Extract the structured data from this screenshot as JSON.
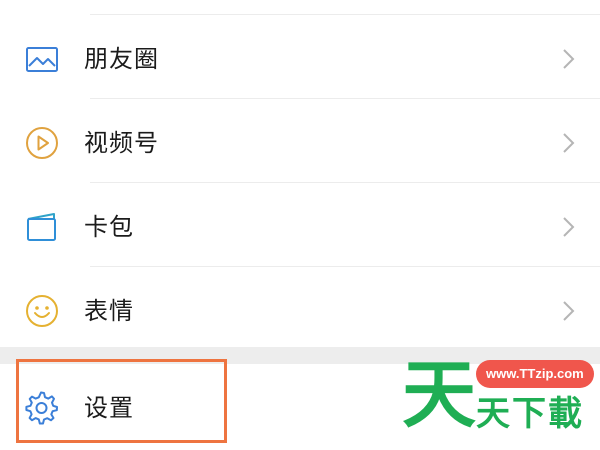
{
  "menu": {
    "items": [
      {
        "label": "朋友圈",
        "icon": "moments-image-icon",
        "icon_color": "#3b7fd8"
      },
      {
        "label": "视频号",
        "icon": "channels-play-icon",
        "icon_color": "#e0a23f"
      },
      {
        "label": "卡包",
        "icon": "card-wallet-icon",
        "icon_color": "#2f8fd8"
      },
      {
        "label": "表情",
        "icon": "sticker-smiley-icon",
        "icon_color": "#e5b131"
      }
    ],
    "settings": {
      "label": "设置",
      "icon": "gear-icon",
      "icon_color": "#3b7fd8"
    }
  },
  "highlight": {
    "color": "#ee7440"
  },
  "watermark": {
    "big_char": "天",
    "url": "www.TTzip.com",
    "name": "天下載",
    "color": "#1fae54",
    "pill_color": "#f0564c"
  }
}
